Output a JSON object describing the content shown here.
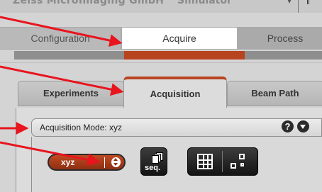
{
  "window": {
    "title_partial": "Zeiss MicroImaging GmbH",
    "mode_partial": "Simulator",
    "dropdown_glyph": "▾",
    "right_icon": "‖"
  },
  "workflow_tabs": [
    {
      "label": "Configuration",
      "state": "inactive"
    },
    {
      "label": "Acquire",
      "state": "active"
    },
    {
      "label": "Process",
      "state": "inactive"
    }
  ],
  "tool_tabs": [
    {
      "label": "Experiments",
      "state": "inactive"
    },
    {
      "label": "Acquisition",
      "state": "active"
    },
    {
      "label": "Beam Path",
      "state": "inactive"
    }
  ],
  "panel": {
    "title": "Acquisition Mode: xyz",
    "help_label": "?",
    "help_icon": "help-icon",
    "collapse_icon": "chevron-down-icon"
  },
  "controls": {
    "scan_mode_value": "xyz",
    "seq_label": "seq.",
    "tile_icon": "tile-scan-icon",
    "positions_icon": "positions-icon"
  },
  "colors": {
    "accent": "#b8441f",
    "arrow": "#e8141e",
    "background": "#d4d4d4"
  }
}
